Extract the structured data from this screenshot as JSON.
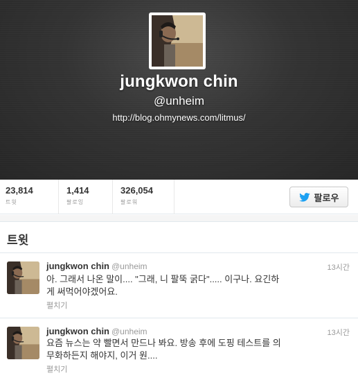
{
  "profile": {
    "name": "jungkwon chin",
    "handle": "@unheim",
    "url": "http://blog.ohmynews.com/litmus/"
  },
  "stats": [
    {
      "value": "23,814",
      "label": "트윗"
    },
    {
      "value": "1,414",
      "label": "팔로잉"
    },
    {
      "value": "326,054",
      "label": "팔로워"
    }
  ],
  "follow_button": {
    "label": "팔로우"
  },
  "section": {
    "title": "트윗"
  },
  "tweets": [
    {
      "name": "jungkwon chin",
      "handle": "@unheim",
      "time": "13시간",
      "text_line1": "아. 그래서 나온 말이.... \"그래, 니 팔뚝 굵다\"..... 이구나. 요긴하",
      "text_line2": "게 써먹어야겠어요.",
      "expand": "펼치기"
    },
    {
      "name": "jungkwon chin",
      "handle": "@unheim",
      "time": "13시간",
      "text_line1": "요즘 뉴스는 약 빨면서 만드나 봐요. 방송 후에 도핑 테스트를 의",
      "text_line2": "무화하든지 해야지, 이거 원....",
      "expand": "펼치기"
    }
  ],
  "colors": {
    "header_bg": "#333333",
    "twitter_blue": "#1da1f2",
    "muted": "#999999"
  },
  "icons": {
    "follow": "twitter-bird-icon"
  }
}
